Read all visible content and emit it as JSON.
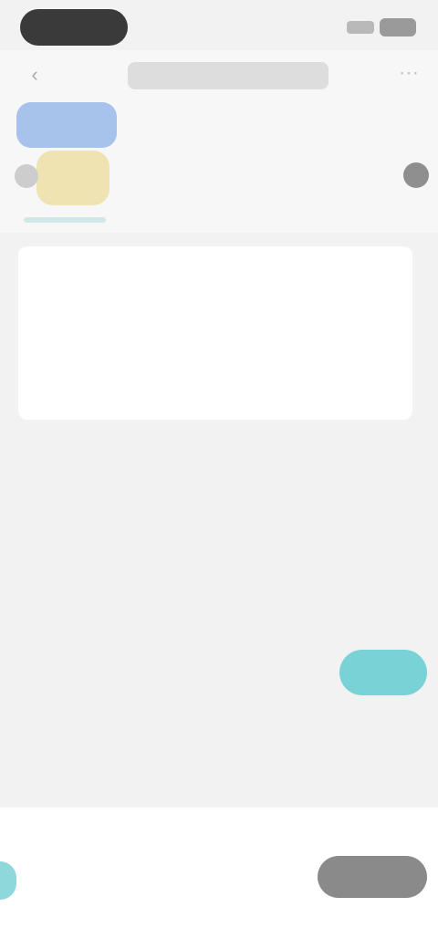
{
  "header": {
    "title": "",
    "tabs": [
      "",
      "",
      ""
    ],
    "subtitle": ""
  },
  "details": {
    "section_label": "",
    "rows": [
      {
        "label": "",
        "value": ""
      },
      {
        "label": "",
        "value": ""
      },
      {
        "label": "",
        "value": ""
      },
      {
        "label": "",
        "value": ""
      },
      {
        "label": "",
        "value": ""
      }
    ]
  },
  "bottom": {
    "left_text": "",
    "button_label": ""
  },
  "colors": {
    "accent": "#79d3d6",
    "thumb_blue": "#a7c3ec",
    "thumb_yellow": "#efe3b2"
  },
  "icons": [
    "back-icon",
    "more-icon"
  ]
}
